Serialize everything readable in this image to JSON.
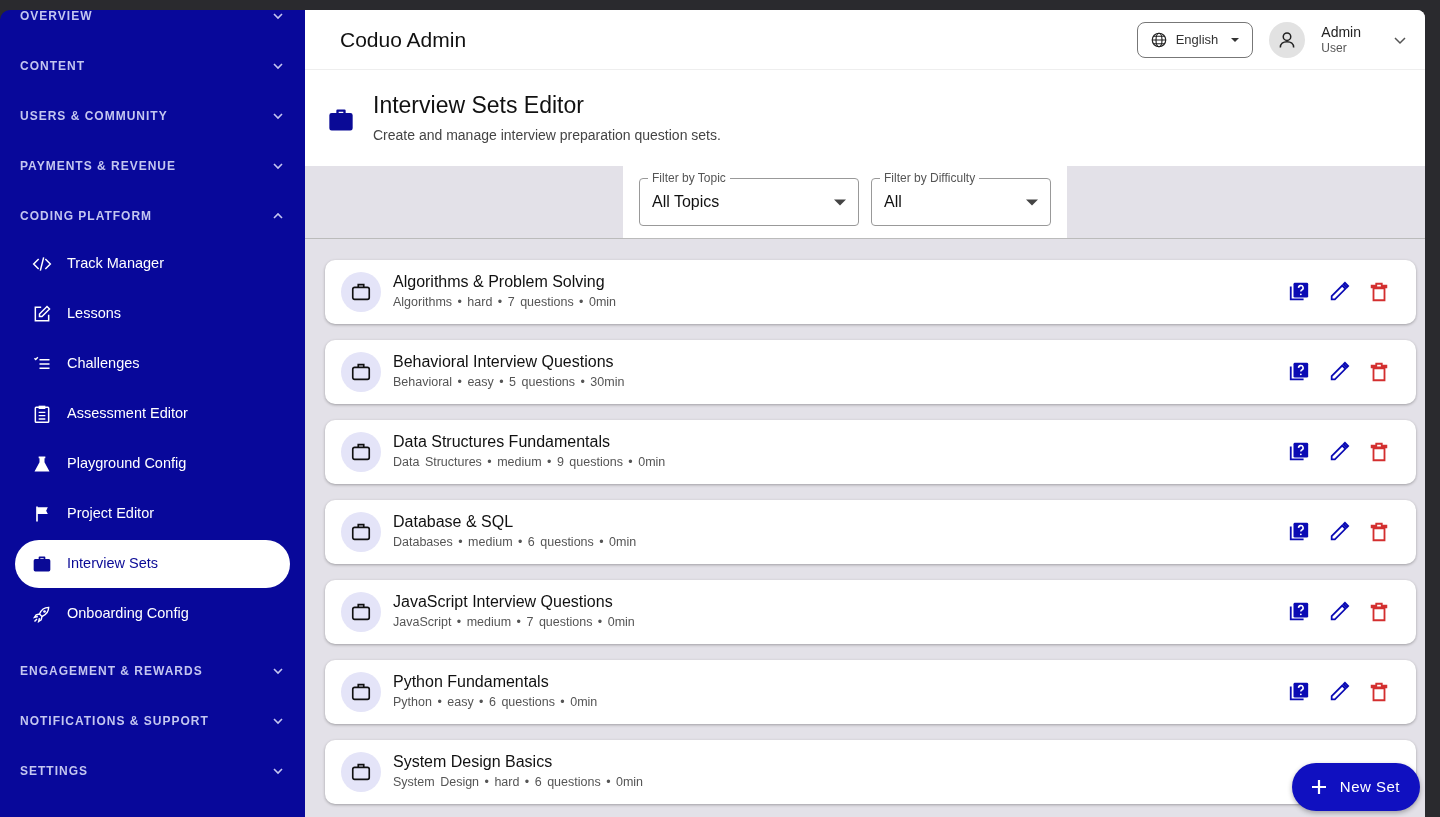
{
  "sidebar": {
    "sections": [
      {
        "label": "OVERVIEW",
        "expanded": false
      },
      {
        "label": "CONTENT",
        "expanded": false
      },
      {
        "label": "USERS & COMMUNITY",
        "expanded": false
      },
      {
        "label": "PAYMENTS & REVENUE",
        "expanded": false
      },
      {
        "label": "CODING PLATFORM",
        "expanded": true,
        "items": [
          {
            "label": "Track Manager",
            "kind": "code",
            "selected": false
          },
          {
            "label": "Lessons",
            "kind": "edit",
            "selected": false
          },
          {
            "label": "Challenges",
            "kind": "checklist",
            "selected": false
          },
          {
            "label": "Assessment Editor",
            "kind": "clipboard",
            "selected": false
          },
          {
            "label": "Playground Config",
            "kind": "flask",
            "selected": false
          },
          {
            "label": "Project Editor",
            "kind": "flag",
            "selected": false
          },
          {
            "label": "Interview Sets",
            "kind": "briefcase",
            "selected": true
          },
          {
            "label": "Onboarding Config",
            "kind": "rocket",
            "selected": false
          }
        ]
      },
      {
        "label": "ENGAGEMENT & REWARDS",
        "expanded": false
      },
      {
        "label": "NOTIFICATIONS & SUPPORT",
        "expanded": false
      },
      {
        "label": "SETTINGS",
        "expanded": false
      }
    ]
  },
  "header": {
    "title": "Coduo Admin",
    "language": "English",
    "user": {
      "name": "Admin",
      "role": "User"
    }
  },
  "page": {
    "title": "Interview Sets Editor",
    "subtitle": "Create and manage interview preparation question sets."
  },
  "filters": [
    {
      "label": "Filter by Topic",
      "value": "All Topics"
    },
    {
      "label": "Filter by Difficulty",
      "value": "All"
    }
  ],
  "sets": [
    {
      "title": "Algorithms & Problem Solving",
      "meta": "Algorithms • hard • 7 questions • 0min",
      "actions": [
        {
          "kind": "questions"
        },
        {
          "kind": "edit"
        },
        {
          "kind": "delete"
        }
      ]
    },
    {
      "title": "Behavioral Interview Questions",
      "meta": "Behavioral • easy • 5 questions • 30min",
      "actions": [
        {
          "kind": "questions"
        },
        {
          "kind": "edit"
        },
        {
          "kind": "delete"
        }
      ]
    },
    {
      "title": "Data Structures Fundamentals",
      "meta": "Data Structures • medium • 9 questions • 0min",
      "actions": [
        {
          "kind": "questions"
        },
        {
          "kind": "edit"
        },
        {
          "kind": "delete"
        }
      ]
    },
    {
      "title": "Database & SQL",
      "meta": "Databases • medium • 6 questions • 0min",
      "actions": [
        {
          "kind": "questions"
        },
        {
          "kind": "edit"
        },
        {
          "kind": "delete"
        }
      ]
    },
    {
      "title": "JavaScript Interview Questions",
      "meta": "JavaScript • medium • 7 questions • 0min",
      "actions": [
        {
          "kind": "questions"
        },
        {
          "kind": "edit"
        },
        {
          "kind": "delete"
        }
      ]
    },
    {
      "title": "Python Fundamentals",
      "meta": "Python • easy • 6 questions • 0min",
      "actions": [
        {
          "kind": "questions"
        },
        {
          "kind": "edit"
        },
        {
          "kind": "delete"
        }
      ]
    },
    {
      "title": "System Design Basics",
      "meta": "System Design • hard • 6 questions • 0min"
    }
  ],
  "fab": {
    "label": "New Set"
  }
}
